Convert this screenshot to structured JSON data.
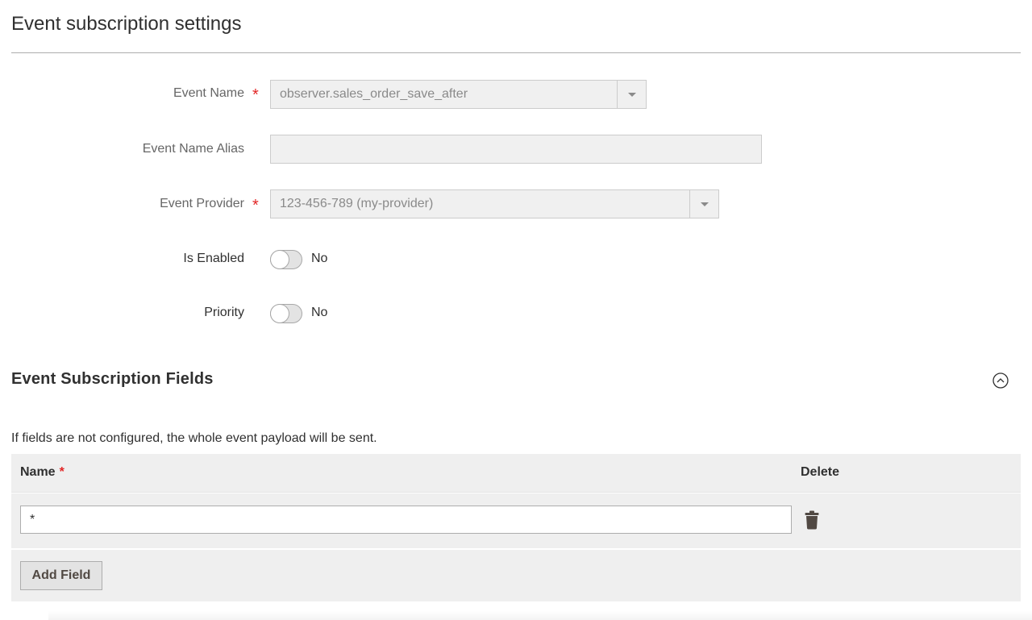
{
  "settings": {
    "title": "Event subscription settings",
    "event_name": {
      "label": "Event Name",
      "required_mark": "*",
      "value": "observer.sales_order_save_after"
    },
    "event_name_alias": {
      "label": "Event Name Alias",
      "value": ""
    },
    "event_provider": {
      "label": "Event Provider",
      "required_mark": "*",
      "value": "123-456-789 (my-provider)"
    },
    "is_enabled": {
      "label": "Is Enabled",
      "state_text": "No",
      "checked": false
    },
    "priority": {
      "label": "Priority",
      "state_text": "No",
      "checked": false
    }
  },
  "fields_section": {
    "title": "Event Subscription Fields",
    "note": "If fields are not configured, the whole event payload will be sent.",
    "columns": {
      "name": "Name",
      "name_required_mark": "*",
      "delete": "Delete"
    },
    "rows": [
      {
        "name": "*"
      }
    ],
    "add_button_label": "Add Field"
  },
  "icons": {
    "select_arrow": "chevron-down-icon",
    "collapse": "collapse-up-icon",
    "delete": "trash-icon"
  },
  "colors": {
    "required": "#e22626",
    "text": "#303030",
    "muted": "#666666",
    "field_bg": "#f0f0f0",
    "grid_bg": "#efefef"
  }
}
